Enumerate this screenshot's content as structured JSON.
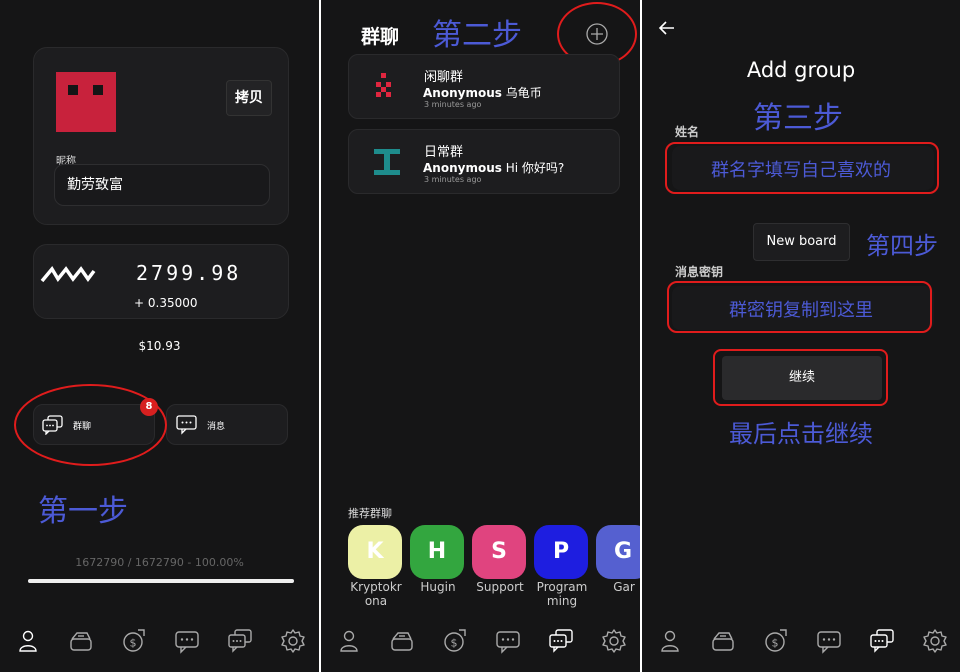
{
  "step_annotations": {
    "step1": "第一步",
    "step2": "第二步",
    "step3": "第三步",
    "step4": "第四步",
    "final": "最后点击继续"
  },
  "profile": {
    "copy_button": "拷贝",
    "nickname_label": "昵称",
    "nickname_value": "勤劳致富",
    "balance": "2799.98",
    "balance_change": "+ 0.35000",
    "fiat_value": "$10.93",
    "groups_button": "群聊",
    "groups_badge": "8",
    "messages_button": "消息",
    "sync_status": "1672790 / 1672790 - 100.00%",
    "sync_progress": 1.0
  },
  "groups": {
    "title": "群聊",
    "list": [
      {
        "name": "闲聊群",
        "sender": "Anonymous",
        "message": "乌龟币",
        "time": "3 minutes ago"
      },
      {
        "name": "日常群",
        "sender": "Anonymous",
        "message": "Hi 你好吗?",
        "time": "3 minutes ago"
      }
    ],
    "recommended_label": "推荐群聊",
    "recommended": [
      {
        "letter": "K",
        "label_line1": "Kryptokr",
        "label_line2": "ona",
        "color": "#ecf0a6"
      },
      {
        "letter": "H",
        "label_line1": "Hugin",
        "label_line2": "",
        "color": "#33a63f"
      },
      {
        "letter": "S",
        "label_line1": "Support",
        "label_line2": "",
        "color": "#e0447f"
      },
      {
        "letter": "P",
        "label_line1": "Program",
        "label_line2": "ming",
        "color": "#1e1ee0"
      },
      {
        "letter": "G",
        "label_line1": "Gar",
        "label_line2": "",
        "color": "#5560d0"
      }
    ]
  },
  "add_group": {
    "title": "Add group",
    "name_label": "姓名",
    "name_placeholder": "群名字填写自己喜欢的",
    "new_board_button": "New board",
    "key_label": "消息密钥",
    "key_placeholder": "群密钥复制到这里",
    "continue_button": "继续"
  },
  "nav_icons": [
    "person-icon",
    "wallet-icon",
    "transfer-icon",
    "message-icon",
    "groups-icon",
    "settings-icon"
  ],
  "colors": {
    "background": "#151516",
    "card": "#1d1d1f",
    "annotation": "#4c5ad6",
    "highlight": "#e01c1c",
    "avatar": "#c8223c",
    "badge": "#d62020"
  }
}
